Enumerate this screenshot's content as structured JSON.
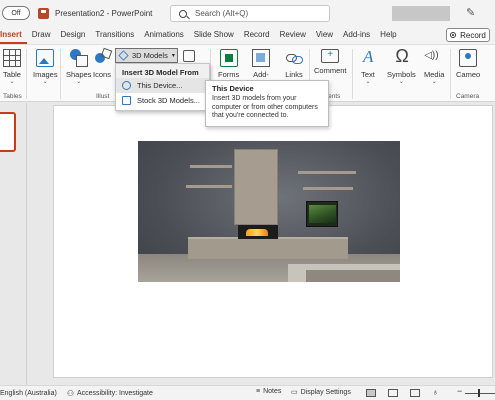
{
  "titlebar": {
    "autosave_label": "Off",
    "document_title": "Presentation2 - PowerPoint",
    "search_placeholder": "Search (Alt+Q)"
  },
  "tabs": [
    "Insert",
    "Draw",
    "Design",
    "Transitions",
    "Animations",
    "Slide Show",
    "Record",
    "Review",
    "View",
    "Add-ins",
    "Help"
  ],
  "active_tab": "Insert",
  "record_button": "Record",
  "ribbon": {
    "table": "Table",
    "images": "Images",
    "shapes": "Shapes",
    "icons": "Icons",
    "models_3d": "3D Models",
    "forms": "Forms",
    "addins": "Add-",
    "links": "Links",
    "comment": "Comment",
    "text": "Text",
    "symbols": "Symbols",
    "media": "Media",
    "cameo": "Cameo",
    "group_tables": "Tables",
    "group_illustrations": "Illust",
    "group_comments": "Comments",
    "group_camera": "Camera"
  },
  "menu": {
    "header": "Insert 3D Model From",
    "items": [
      "This Device...",
      "Stock 3D Models..."
    ]
  },
  "tooltip": {
    "title": "This Device",
    "body": "Insert 3D models from your computer or from other computers that you're connected to."
  },
  "statusbar": {
    "language": "English (Australia)",
    "accessibility": "Accessibility: Investigate",
    "notes": "Notes",
    "display_settings": "Display Settings"
  },
  "colors": {
    "accent": "#c43e1c",
    "icon_blue": "#2b78c4"
  }
}
